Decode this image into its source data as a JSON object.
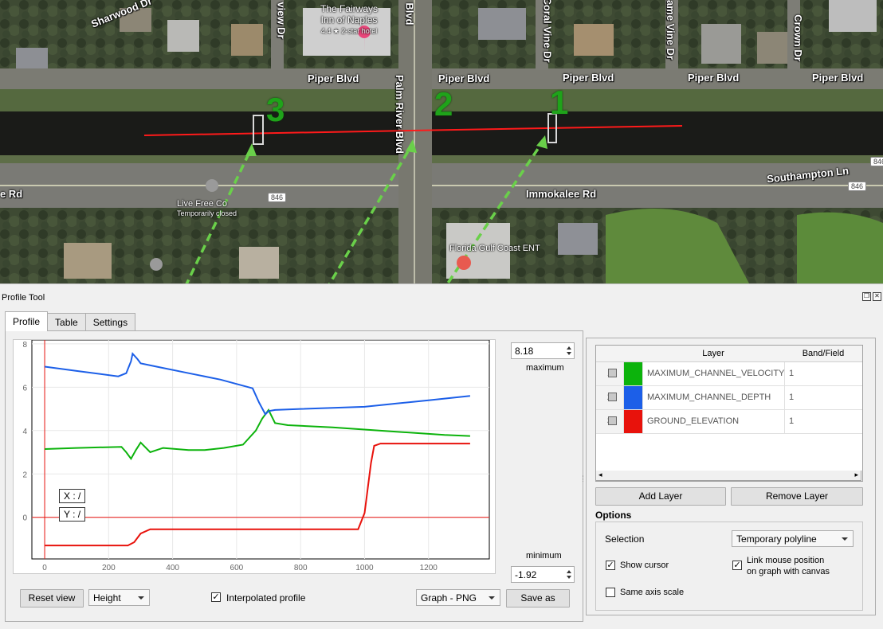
{
  "map": {
    "roads": [
      "Piper Blvd",
      "Piper Blvd",
      "Piper Blvd",
      "Piper Blvd",
      "Piper Blvd",
      "Immokalee Rd",
      "Southampton Ln",
      "e Rd",
      "Palm River Blvd"
    ],
    "streets_vertical": [
      "view Dr",
      "Blvd",
      "Coral Vine Dr",
      "ame Vine Dr",
      "Crown Dr",
      "Sharwood Dr"
    ],
    "hotel": {
      "name": "The Fairways Inn of Naples",
      "line1": "The Fairways",
      "line2": "Inn of Naples",
      "rating": "4.4 ★ 2-star hotel"
    },
    "poi_live_free": {
      "name": "Live Free Co",
      "status": "Temporarily closed"
    },
    "poi_ent": "Florida Gulf Coast ENT",
    "shield_846": "846",
    "markers": [
      "3",
      "2",
      "1"
    ]
  },
  "panel": {
    "title": "Profile Tool",
    "tabs": [
      "Profile",
      "Table",
      "Settings"
    ],
    "active_tab": "Profile",
    "maximum_value": "8.18",
    "maximum_label": "maximum",
    "minimum_label": "minimum",
    "minimum_value": "-1.92",
    "cursor_x": "X : /",
    "cursor_y": "Y : /",
    "reset_view": "Reset view",
    "plot_mode": "Height",
    "interpolated_label": "Interpolated profile",
    "interpolated_checked": true,
    "export_format": "Graph - PNG",
    "save_as": "Save as"
  },
  "layers": {
    "headers": [
      "Layer",
      "Band/Field"
    ],
    "rows": [
      {
        "num": "1",
        "color": "#0cb30c",
        "name": "MAXIMUM_CHANNEL_VELOCITY",
        "band": "1"
      },
      {
        "num": "2",
        "color": "#1c5fe8",
        "name": "MAXIMUM_CHANNEL_DEPTH",
        "band": "1"
      },
      {
        "num": "3",
        "color": "#e8120c",
        "name": "GROUND_ELEVATION",
        "band": "1"
      }
    ],
    "add_layer": "Add Layer",
    "remove_layer": "Remove Layer"
  },
  "options": {
    "title": "Options",
    "selection_label": "Selection",
    "selection_value": "Temporary polyline",
    "show_cursor": "Show cursor",
    "show_cursor_checked": true,
    "link_mouse_line1": "Link mouse position",
    "link_mouse_line2": "on graph with canvas",
    "link_mouse_checked": true,
    "same_axis": "Same axis scale",
    "same_axis_checked": false
  },
  "chart_data": {
    "type": "line",
    "xlabel": "",
    "ylabel": "",
    "xlim": [
      -40,
      1390
    ],
    "ylim": [
      -1.92,
      8.18
    ],
    "x_ticks": [
      "0",
      "200",
      "400",
      "600",
      "800",
      "1000",
      "1200"
    ],
    "y_ticks": [
      "8",
      "6",
      "4",
      "2",
      "0"
    ],
    "series": [
      {
        "name": "MAXIMUM_CHANNEL_VELOCITY",
        "color": "#0cb30c",
        "x": [
          0,
          100,
          240,
          255,
          270,
          285,
          300,
          330,
          370,
          450,
          500,
          560,
          620,
          660,
          680,
          700,
          720,
          760,
          900,
          1100,
          1250,
          1330
        ],
        "y": [
          3.15,
          3.2,
          3.25,
          3.0,
          2.7,
          3.1,
          3.45,
          3.0,
          3.2,
          3.1,
          3.1,
          3.2,
          3.35,
          4.0,
          4.55,
          4.95,
          4.35,
          4.25,
          4.15,
          3.95,
          3.8,
          3.75
        ]
      },
      {
        "name": "MAXIMUM_CHANNEL_DEPTH",
        "color": "#1c5fe8",
        "x": [
          0,
          100,
          230,
          255,
          270,
          275,
          290,
          300,
          350,
          450,
          550,
          650,
          670,
          690,
          700,
          720,
          800,
          1000,
          1100,
          1200,
          1330
        ],
        "y": [
          6.95,
          6.75,
          6.5,
          6.65,
          7.2,
          7.55,
          7.3,
          7.1,
          6.95,
          6.65,
          6.35,
          5.95,
          5.3,
          4.75,
          4.9,
          4.95,
          5.0,
          5.1,
          5.25,
          5.4,
          5.6
        ]
      },
      {
        "name": "GROUND_ELEVATION",
        "color": "#e8120c",
        "x": [
          0,
          260,
          280,
          300,
          330,
          500,
          800,
          980,
          1000,
          1020,
          1030,
          1050,
          1100,
          1200,
          1330
        ],
        "y": [
          -1.3,
          -1.3,
          -1.15,
          -0.75,
          -0.55,
          -0.55,
          -0.55,
          -0.55,
          0.2,
          2.5,
          3.3,
          3.4,
          3.4,
          3.4,
          3.4
        ]
      }
    ],
    "grid": true,
    "legend": "none"
  }
}
